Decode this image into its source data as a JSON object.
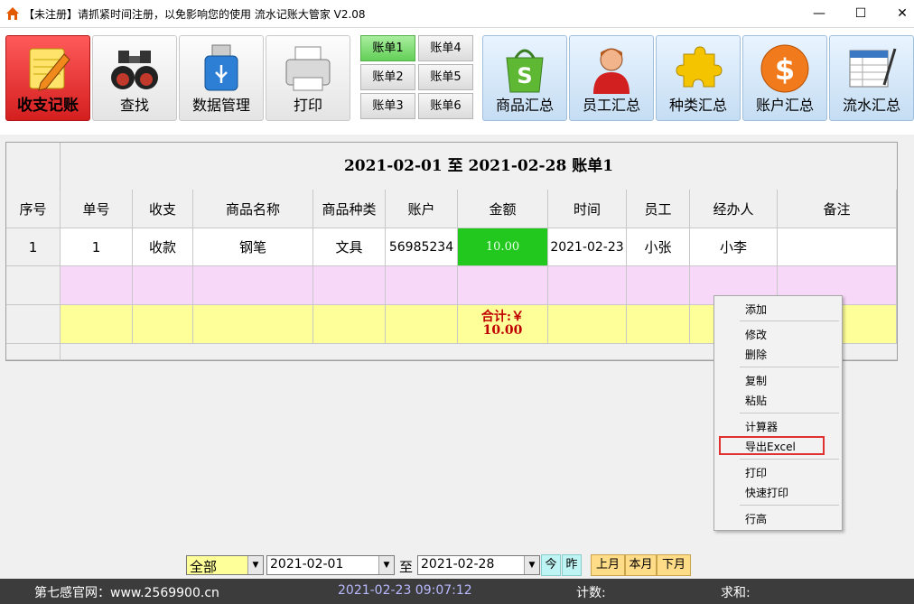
{
  "window": {
    "title": "【未注册】请抓紧时间注册，以免影响您的使用    流水记账大管家   V2.08",
    "min": "—",
    "max": "☐",
    "close": "✕"
  },
  "toolbar": {
    "left_buttons": [
      "收支记账",
      "查找",
      "数据管理",
      "打印"
    ],
    "ledgers": [
      "账单1",
      "账单2",
      "账单3",
      "账单4",
      "账单5",
      "账单6"
    ],
    "selected_ledger": "账单1",
    "right_buttons": [
      "商品汇总",
      "员工汇总",
      "种类汇总",
      "账户汇总",
      "流水汇总"
    ]
  },
  "grid": {
    "title": "2021-02-01  至  2021-02-28  账单1",
    "columns": [
      "序号",
      "单号",
      "收支",
      "商品名称",
      "商品种类",
      "账户",
      "金额",
      "时间",
      "员工",
      "经办人",
      "备注"
    ],
    "rows": [
      [
        "1",
        "1",
        "收款",
        "钢笔",
        "文具",
        "56985234",
        "10.00",
        "2021-02-23",
        "小张",
        "小李",
        ""
      ]
    ],
    "total_label": "合计:￥",
    "total_value": "10.00"
  },
  "context_menu": {
    "items": [
      "添加",
      "修改",
      "删除",
      "复制",
      "粘贴",
      "计算器",
      "导出Excel",
      "打印",
      "快速打印",
      "行高"
    ],
    "highlighted": "导出Excel"
  },
  "filter": {
    "scope": "全部",
    "date_from": "2021-02-01",
    "to_label": "至",
    "date_to": "2021-02-28",
    "today": "今",
    "yesterday": "昨",
    "last_month": "上月",
    "this_month": "本月",
    "next_month": "下月"
  },
  "status": {
    "website": "第七感官网：www.2569900.cn",
    "datetime": "2021-02-23 09:07:12",
    "count_label": "计数:",
    "sum_label": "求和:"
  },
  "colors": {
    "active_button": "#e02020",
    "selected_ledger": "#66d05a",
    "amount_cell": "#22c81e",
    "pink_row": "#f8d8f8",
    "total_row": "#ffff99",
    "total_text": "#c00000",
    "statusbar": "#3c3c3c"
  }
}
